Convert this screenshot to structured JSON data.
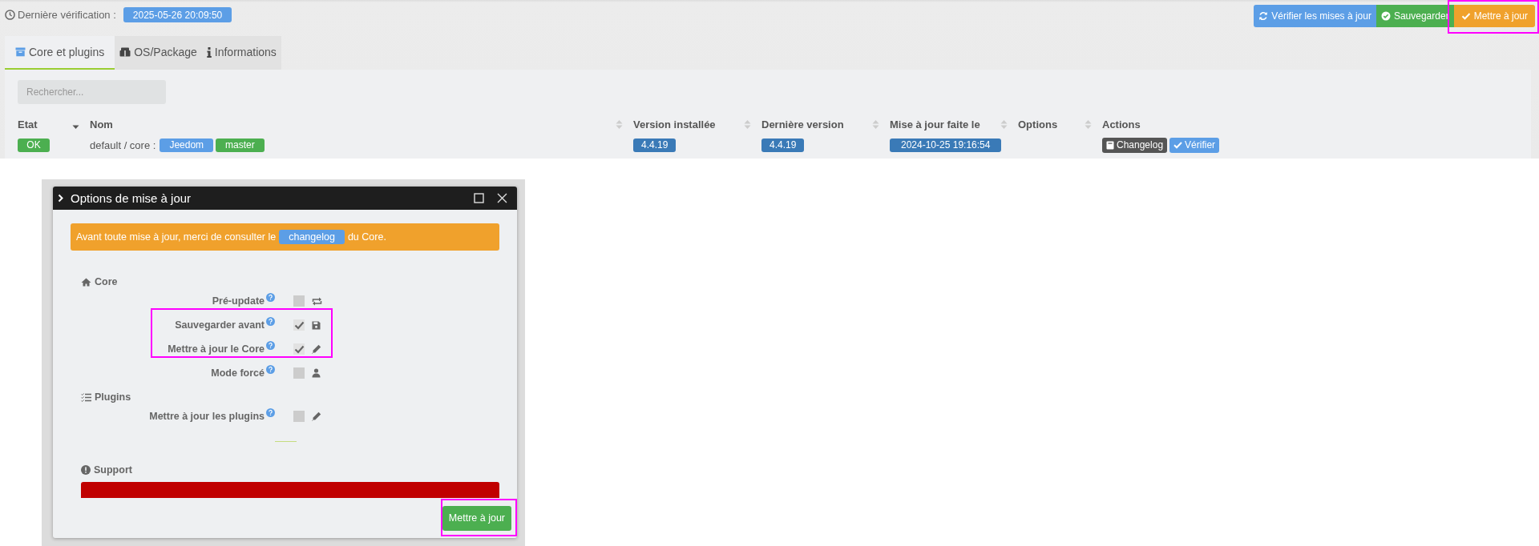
{
  "header": {
    "last_check_label": "Dernière vérification :",
    "last_check_value": "2025-05-26 20:09:50"
  },
  "toolbar": [
    {
      "label": "Vérifier les mises à jour",
      "kind": "check"
    },
    {
      "label": "Sauvegarder",
      "kind": "save"
    },
    {
      "label": "Mettre à jour",
      "kind": "update"
    }
  ],
  "tabs": [
    {
      "label": "Core et plugins",
      "selected": true
    },
    {
      "label": "OS/Package",
      "selected": false
    },
    {
      "label": "Informations",
      "selected": false
    }
  ],
  "search": {
    "placeholder": "Rechercher..."
  },
  "table": {
    "columns": [
      {
        "label": "Etat",
        "sortable": true,
        "sorted": true
      },
      {
        "label": "Nom",
        "sortable": true,
        "sorted": false
      },
      {
        "label": "Version installée",
        "sortable": true,
        "sorted": false
      },
      {
        "label": "Dernière version",
        "sortable": true,
        "sorted": false
      },
      {
        "label": "Mise à jour faite le",
        "sortable": true,
        "sorted": false
      },
      {
        "label": "Options",
        "sortable": true,
        "sorted": false
      },
      {
        "label": "Actions"
      }
    ],
    "rows": [
      {
        "status": "OK",
        "name": "default / core :",
        "tags": [
          {
            "label": "Jeedom",
            "color": "#5c9ee6"
          },
          {
            "label": "master",
            "color": "#4caf50"
          }
        ],
        "installed": "4.4.19",
        "latest": "4.4.19",
        "updated": "2024-10-25 19:16:54",
        "actions": [
          {
            "label": "Changelog",
            "kind": "changelog"
          },
          {
            "label": "Vérifier",
            "kind": "verify"
          }
        ]
      }
    ]
  },
  "dialog": {
    "title": "Options de mise à jour",
    "notice": {
      "before": "Avant toute mise à jour, merci de consulter le",
      "link": "changelog",
      "after": "du Core."
    },
    "sections": [
      {
        "title": "Core",
        "options": [
          {
            "label": "Pré-update",
            "checked": false
          },
          {
            "label": "Sauvegarder avant",
            "checked": true
          },
          {
            "label": "Mettre à jour le Core",
            "checked": true
          },
          {
            "label": "Mode forcé",
            "checked": false
          }
        ]
      },
      {
        "title": "Plugins",
        "options": [
          {
            "label": "Mettre à jour les plugins",
            "checked": false
          }
        ]
      },
      {
        "title": "Support"
      }
    ],
    "button": "Mettre à jour"
  }
}
